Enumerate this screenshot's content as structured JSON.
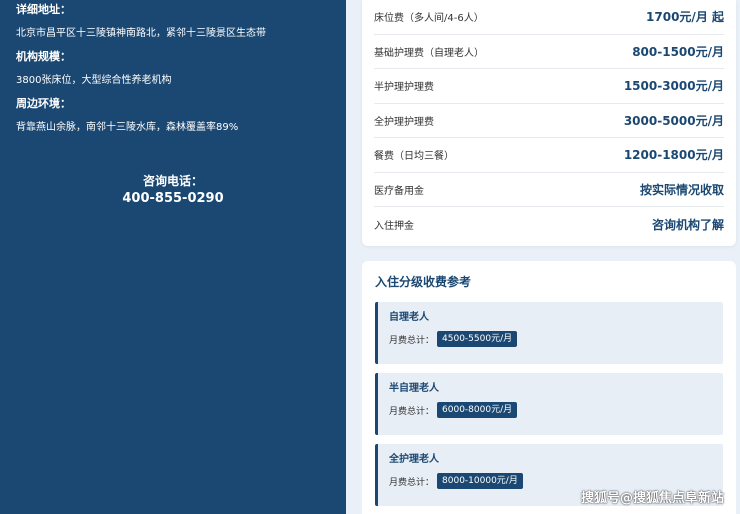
{
  "info": {
    "address_label": "详细地址：",
    "address_value": "北京市昌平区十三陵镇神南路北，紧邻十三陵景区生态带",
    "scale_label": "机构规模：",
    "scale_value": "3800张床位，大型综合性养老机构",
    "env_label": "周边环境：",
    "env_value": "背靠燕山余脉，南邻十三陵水库，森林覆盖率89%"
  },
  "contact": {
    "label": "咨询电话：",
    "phone": "400-855-0290"
  },
  "fees": [
    {
      "name": "床位费（多人间/4-6人）",
      "price": "1700元/月 起"
    },
    {
      "name": "基础护理费（自理老人）",
      "price": "800-1500元/月"
    },
    {
      "name": "半护理护理费",
      "price": "1500-3000元/月"
    },
    {
      "name": "全护理护理费",
      "price": "3000-5000元/月"
    },
    {
      "name": "餐费（日均三餐）",
      "price": "1200-1800元/月"
    },
    {
      "name": "医疗备用金",
      "price": "按实际情况收取"
    },
    {
      "name": "入住押金",
      "price": "咨询机构了解"
    }
  ],
  "tiers": {
    "title": "入住分级收费参考",
    "items": [
      {
        "name": "自理老人",
        "label": "月费总计：",
        "total": "4500-5500元/月"
      },
      {
        "name": "半自理老人",
        "label": "月费总计：",
        "total": "6000-8000元/月"
      },
      {
        "name": "全护理老人",
        "label": "月费总计：",
        "total": "8000-10000元/月"
      }
    ]
  },
  "watermark": "搜狐号@搜狐焦点阜新站",
  "colors": {
    "primary": "#1b4872",
    "background": "#e9f0f7",
    "tier_bg": "#e8eef6"
  }
}
